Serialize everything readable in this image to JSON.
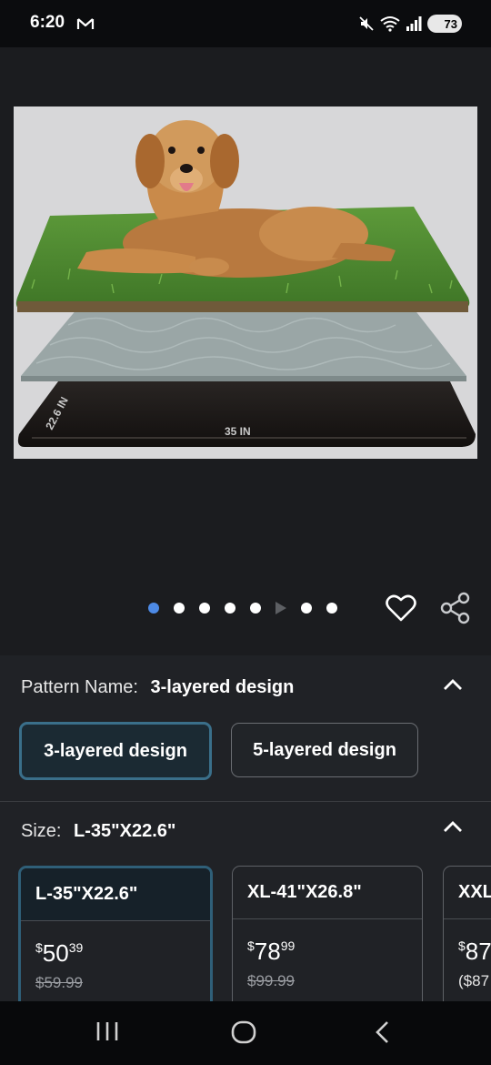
{
  "status_bar": {
    "time": "6:20",
    "battery": "73"
  },
  "product_image": {
    "width_label": "35 IN",
    "depth_label": "22.6 IN"
  },
  "carousel": {
    "total_dots": 7,
    "active_index": 0,
    "video_marker_after": 5
  },
  "pattern": {
    "label": "Pattern Name:",
    "value": "3-layered design",
    "options": [
      "3-layered design",
      "5-layered design"
    ],
    "selected_index": 0
  },
  "size": {
    "label": "Size:",
    "value": "L-35\"X22.6\"",
    "cards": [
      {
        "name": "L-35\"X22.6\"",
        "price_symbol": "$",
        "price_whole": "50",
        "price_fraction": "39",
        "was": "$59.99"
      },
      {
        "name": "XL-41\"X26.8\"",
        "price_symbol": "$",
        "price_whole": "78",
        "price_fraction": "99",
        "was": "$99.99"
      },
      {
        "name": "XXL",
        "price_symbol": "$",
        "price_whole": "87",
        "price_fraction": "",
        "unit_price": "($87"
      }
    ]
  },
  "colors": {
    "accent": "#4d8ae6",
    "selected_border": "#3a6f8a"
  }
}
